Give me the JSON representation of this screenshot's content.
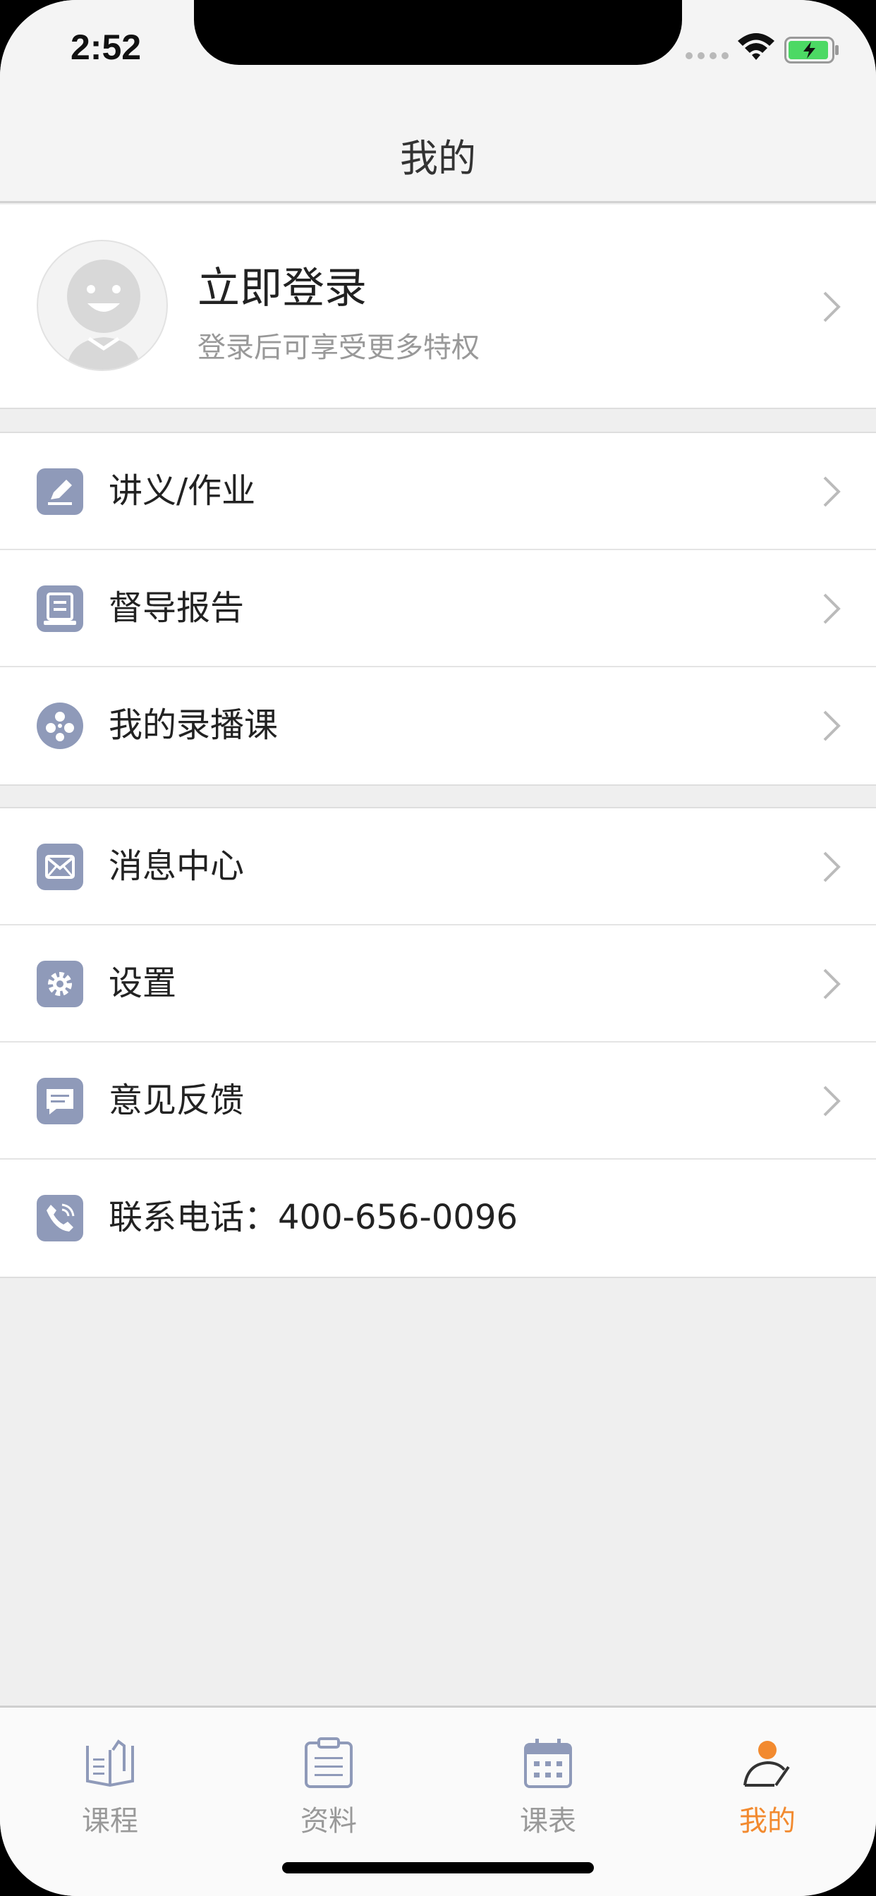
{
  "status_bar": {
    "time": "2:52"
  },
  "nav": {
    "title": "我的"
  },
  "profile": {
    "title": "立即登录",
    "subtitle": "登录后可享受更多特权"
  },
  "group1": [
    {
      "label": "讲义/作业",
      "icon": "pencil-icon"
    },
    {
      "label": "督导报告",
      "icon": "report-icon"
    },
    {
      "label": "我的录播课",
      "icon": "film-reel-icon"
    }
  ],
  "group2": [
    {
      "label": "消息中心",
      "icon": "mail-icon"
    },
    {
      "label": "设置",
      "icon": "gear-icon"
    },
    {
      "label": "意见反馈",
      "icon": "chat-bubble-icon"
    },
    {
      "label": "联系电话：400-656-0096",
      "icon": "phone-icon"
    }
  ],
  "tabs": [
    {
      "label": "课程",
      "icon": "book-icon"
    },
    {
      "label": "资料",
      "icon": "clipboard-icon"
    },
    {
      "label": "课表",
      "icon": "calendar-icon"
    },
    {
      "label": "我的",
      "icon": "user-icon",
      "active": true
    }
  ],
  "colors": {
    "accent": "#f28a2f",
    "icon_bg": "#8f9ab9",
    "background": "#efefef"
  }
}
